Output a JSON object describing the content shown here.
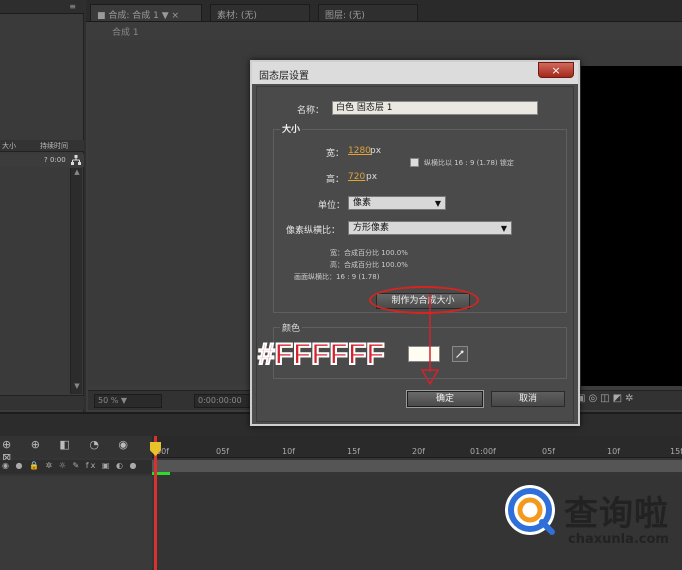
{
  "left_panel": {
    "col_size": "大小",
    "col_duration": "持续时间",
    "row_value": "? 0:00",
    "menu_glyph": "≡"
  },
  "comp_panel": {
    "tabs": [
      {
        "label": "■ 合成: 合成 1  ▼ ×"
      },
      {
        "label": "素材: (无)"
      },
      {
        "label": "图层: (无)"
      }
    ],
    "crumb": "合成 1",
    "zoom": "50 %  ▼",
    "time": "0:00:00:00"
  },
  "timeline": {
    "ticks": [
      "00f",
      "05f",
      "10f",
      "15f",
      "20f",
      "01:00f",
      "05f",
      "10f",
      "15f"
    ],
    "tools_glyphs": "⊕ ⊕ ◧ ◔ ◉ ⊠",
    "switch_glyphs": "◉ ● 🔒 ✲ ☼ ✎ fx ▣ ◐ ●"
  },
  "dialog": {
    "title": "固态层设置",
    "close": "×",
    "name_label": "名称：",
    "name_value": "白色 固态层 1",
    "size_title": "大小",
    "width_label": "宽：",
    "width_value": "1280",
    "width_unit": "px",
    "height_label": "高：",
    "height_value": "720",
    "height_unit": "px",
    "lock_label": "纵横比以 16 : 9 (1.78) 锁定",
    "lock_checked": false,
    "units_label": "单位：",
    "units_value": "像素",
    "aspect_label": "像素纵横比：",
    "aspect_value": "方形像素",
    "info_width": "宽：合成百分比 100.0%",
    "info_height": "高：合成百分比 100.0%",
    "info_frame": "画面纵横比：16 : 9 (1.78)",
    "make_comp_size": "制作为合成大小",
    "color_title": "颜色",
    "swatch_color": "#FFFDF2",
    "ok": "确定",
    "cancel": "取消"
  },
  "annotation": {
    "hex": "#FFFFFF",
    "color": "#D4222C"
  },
  "watermark": {
    "brand": "查询啦",
    "url": "chaxunla.com"
  }
}
